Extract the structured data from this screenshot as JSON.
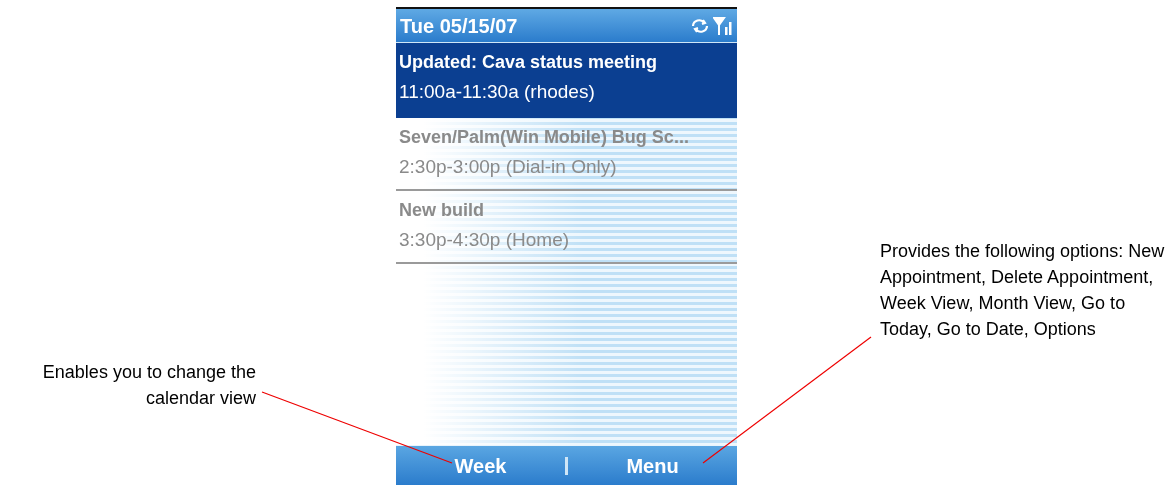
{
  "title_bar": {
    "date": "Tue 05/15/07"
  },
  "appointments": [
    {
      "title": "Updated: Cava status meeting",
      "time": "11:00a-11:30a (rhodes)",
      "selected": true
    },
    {
      "title": "Seven/Palm(Win Mobile) Bug Sc...",
      "time": "2:30p-3:00p (Dial-in Only)",
      "selected": false
    },
    {
      "title": "New build",
      "time": "3:30p-4:30p (Home)",
      "selected": false
    }
  ],
  "softkeys": [
    "Week",
    "Menu"
  ],
  "callouts": {
    "left": "Enables you to change the calendar view",
    "right": "Provides the following options: New Appointment, Delete Appointment, Week View, Month View, Go to Today, Go to Date, Options"
  }
}
